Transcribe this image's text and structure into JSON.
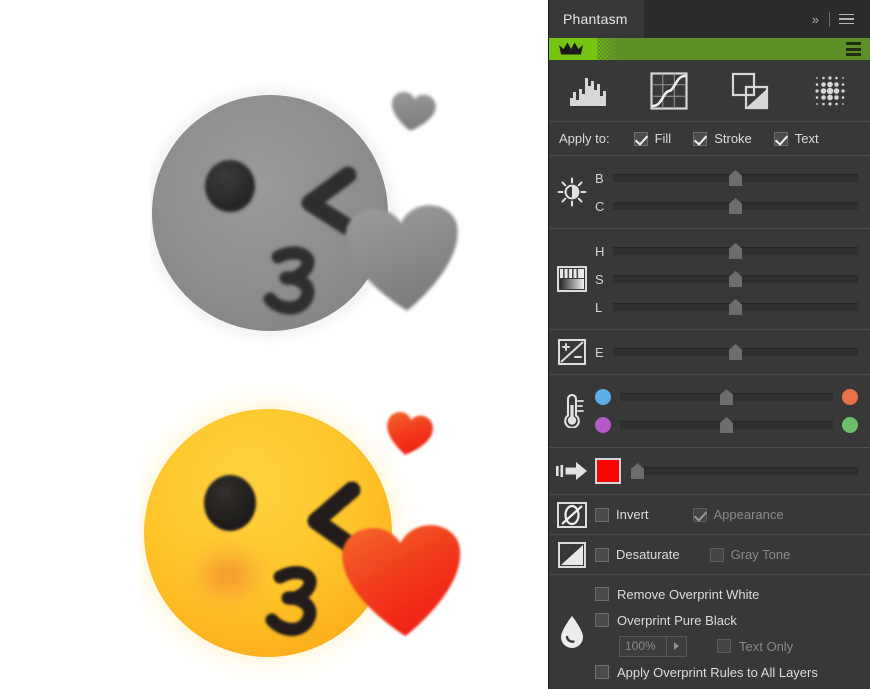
{
  "window": {
    "tab_title": "Phantasm",
    "collapse_icon": "chevron-double-right-icon",
    "menu_icon": "hamburger-menu-icon"
  },
  "promo": {
    "crown_icon": "crown-icon",
    "menu_icon": "hamburger-menu-icon",
    "bright_color": "#76c412",
    "base_color": "#5f8f27"
  },
  "toolbar": {
    "buttons": [
      {
        "name": "levels-histogram-icon",
        "label": "Levels"
      },
      {
        "name": "curves-icon",
        "label": "Curves"
      },
      {
        "name": "halftone-shapes-icon",
        "label": "Halftone"
      },
      {
        "name": "dot-pattern-icon",
        "label": "Pattern"
      }
    ]
  },
  "apply_to": {
    "label": "Apply to:",
    "options": [
      {
        "label": "Fill",
        "checked": true,
        "enabled": true
      },
      {
        "label": "Stroke",
        "checked": true,
        "enabled": true
      },
      {
        "label": "Text",
        "checked": true,
        "enabled": true
      }
    ]
  },
  "brightness_contrast": {
    "icon": "brightness-sun-icon",
    "sliders": [
      {
        "label": "B",
        "value": 50
      },
      {
        "label": "C",
        "value": 50
      }
    ]
  },
  "hsl": {
    "icon": "gradient-bars-icon",
    "sliders": [
      {
        "label": "H",
        "value": 50
      },
      {
        "label": "S",
        "value": 50
      },
      {
        "label": "L",
        "value": 50
      }
    ]
  },
  "exposure": {
    "icon": "exposure-plus-minus-icon",
    "sliders": [
      {
        "label": "E",
        "value": 50
      }
    ]
  },
  "temperature": {
    "icon": "thermometer-icon",
    "sliders": [
      {
        "left_dot": "#5aaeea",
        "right_dot": "#e8714a",
        "value": 50
      },
      {
        "left_dot": "#b558c8",
        "right_dot": "#6cbe6c",
        "value": 50
      }
    ]
  },
  "colorize": {
    "icon": "arrow-right-motion-icon",
    "swatch_color": "#ff0000",
    "value": 0
  },
  "invert": {
    "icon": "invert-circle-icon",
    "options": [
      {
        "label": "Invert",
        "checked": false,
        "enabled": true
      },
      {
        "label": "Appearance",
        "checked": true,
        "enabled": false
      }
    ]
  },
  "desaturate": {
    "icon": "desaturate-gradient-icon",
    "options": [
      {
        "label": "Desaturate",
        "checked": false,
        "enabled": true
      },
      {
        "label": "Gray Tone",
        "checked": false,
        "enabled": false
      }
    ]
  },
  "overprint": {
    "icon": "ink-drop-icon",
    "remove_white": {
      "label": "Remove Overprint White",
      "checked": false
    },
    "pure_black": {
      "label": "Overprint Pure Black",
      "checked": false
    },
    "percent_value": "100%",
    "percent_dropdown_icon": "triangle-right-icon",
    "text_only": {
      "label": "Text Only",
      "checked": false,
      "enabled": false
    },
    "all_layers": {
      "label": "Apply Overprint Rules to All Layers",
      "checked": false
    }
  },
  "artwork": {
    "top": {
      "name": "face-blowing-a-kiss-emoji-grayscale",
      "face_color": "#8e8e8e",
      "eye_color": "#2e2e2e",
      "heart_color": "#909090"
    },
    "bottom": {
      "name": "face-blowing-a-kiss-emoji-color",
      "face_color": "#ffc62b",
      "eye_color": "#211f1e",
      "heart_color": "#f5401f",
      "blush_color": "#f2852a"
    }
  }
}
